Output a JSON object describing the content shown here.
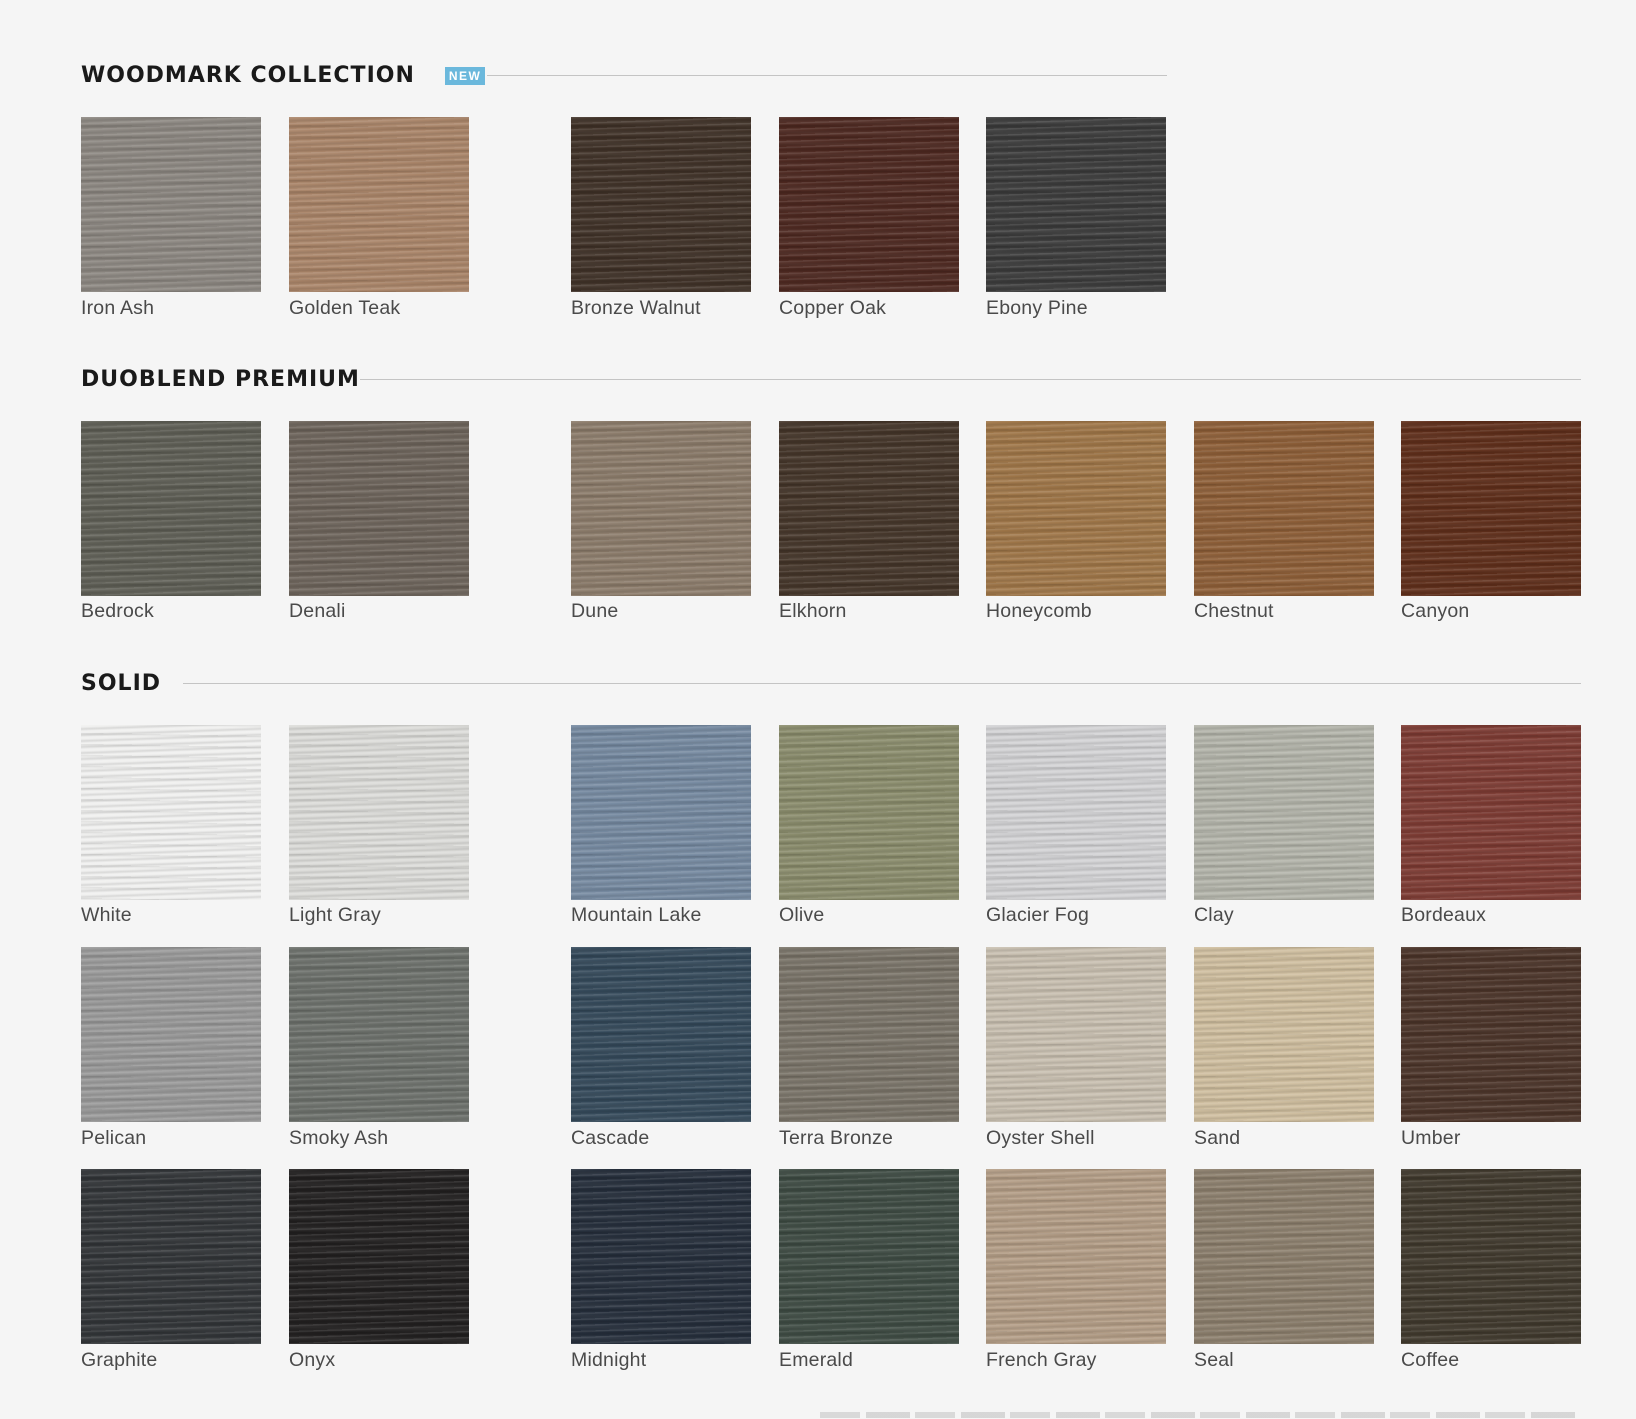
{
  "sections": [
    {
      "title": "WOODMARK COLLECTION",
      "badge": "NEW",
      "swatches": [
        {
          "label": "Iron Ash",
          "color": "#8b8680"
        },
        {
          "label": "Golden Teak",
          "color": "#a98468"
        },
        {
          "label": "Bronze Walnut",
          "color": "#3f3127"
        },
        {
          "label": "Copper Oak",
          "color": "#4d2820"
        },
        {
          "label": "Ebony Pine",
          "color": "#3b3b3b"
        }
      ]
    },
    {
      "title": "DUOBLEND PREMIUM",
      "swatches": [
        {
          "label": "Bedrock",
          "color": "#5e5e55"
        },
        {
          "label": "Denali",
          "color": "#6c635a"
        },
        {
          "label": "Dune",
          "color": "#8b7b6a"
        },
        {
          "label": "Elkhorn",
          "color": "#443529"
        },
        {
          "label": "Honeycomb",
          "color": "#9f7648"
        },
        {
          "label": "Chestnut",
          "color": "#8d5e37"
        },
        {
          "label": "Canyon",
          "color": "#5f2e1a"
        }
      ]
    },
    {
      "title": "SOLID",
      "swatches": [
        {
          "label": "White",
          "color": "#f0f0ef"
        },
        {
          "label": "Light Gray",
          "color": "#dcdcd9"
        },
        {
          "label": "Mountain Lake",
          "color": "#7589a0"
        },
        {
          "label": "Olive",
          "color": "#8a8c6c"
        },
        {
          "label": "Glacier Fog",
          "color": "#d3d3d5"
        },
        {
          "label": "Clay",
          "color": "#b3b4aa"
        },
        {
          "label": "Bordeaux",
          "color": "#7d3b33"
        },
        {
          "label": "Pelican",
          "color": "#999999"
        },
        {
          "label": "Smoky Ash",
          "color": "#6c706b"
        },
        {
          "label": "Cascade",
          "color": "#34495a"
        },
        {
          "label": "Terra Bronze",
          "color": "#797368"
        },
        {
          "label": "Oyster Shell",
          "color": "#c8bfb0"
        },
        {
          "label": "Sand",
          "color": "#cfbe9f"
        },
        {
          "label": "Umber",
          "color": "#4b3429"
        },
        {
          "label": "Graphite",
          "color": "#323538"
        },
        {
          "label": "Onyx",
          "color": "#222020"
        },
        {
          "label": "Midnight",
          "color": "#252e3b"
        },
        {
          "label": "Emerald",
          "color": "#3e4b43"
        },
        {
          "label": "French Gray",
          "color": "#b39d86"
        },
        {
          "label": "Seal",
          "color": "#8b7e6c"
        },
        {
          "label": "Coffee",
          "color": "#40392d"
        }
      ]
    }
  ]
}
